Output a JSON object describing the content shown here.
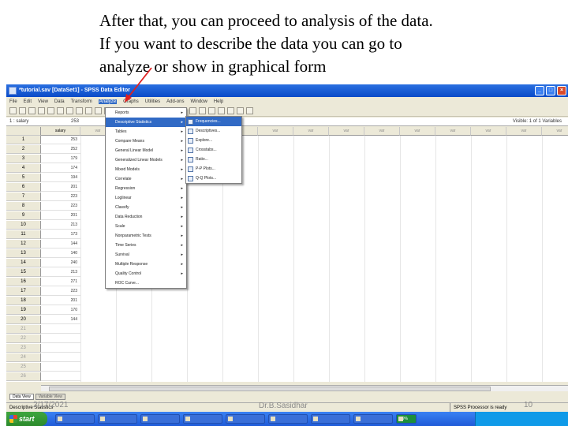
{
  "caption": {
    "line1": "After that, you can proceed to analysis of the data.",
    "line2": "If you want to describe the data you can go to",
    "line3": "analyze  or show in graphical form"
  },
  "window": {
    "title": "*tutorial.sav [DataSet1] - SPSS Data Editor"
  },
  "menubar": [
    "File",
    "Edit",
    "View",
    "Data",
    "Transform",
    "Analyze",
    "Graphs",
    "Utilities",
    "Add-ons",
    "Window",
    "Help"
  ],
  "cellbar": {
    "ref": "1 : salary",
    "value": "253",
    "visible": "Visible: 1 of 1 Variables"
  },
  "grid": {
    "first_column_header": "salary",
    "empty_header": "var",
    "rows": [
      {
        "n": "1",
        "v": "253"
      },
      {
        "n": "2",
        "v": "252"
      },
      {
        "n": "3",
        "v": "179"
      },
      {
        "n": "4",
        "v": "174"
      },
      {
        "n": "5",
        "v": "194"
      },
      {
        "n": "6",
        "v": "201"
      },
      {
        "n": "7",
        "v": "223"
      },
      {
        "n": "8",
        "v": "223"
      },
      {
        "n": "9",
        "v": "201"
      },
      {
        "n": "10",
        "v": "213"
      },
      {
        "n": "11",
        "v": "173"
      },
      {
        "n": "12",
        "v": "144"
      },
      {
        "n": "13",
        "v": "140"
      },
      {
        "n": "14",
        "v": "240"
      },
      {
        "n": "15",
        "v": "213"
      },
      {
        "n": "16",
        "v": "271"
      },
      {
        "n": "17",
        "v": "223"
      },
      {
        "n": "18",
        "v": "201"
      },
      {
        "n": "19",
        "v": "170"
      },
      {
        "n": "20",
        "v": "144"
      },
      {
        "n": "21",
        "v": ""
      },
      {
        "n": "22",
        "v": ""
      },
      {
        "n": "23",
        "v": ""
      },
      {
        "n": "24",
        "v": ""
      },
      {
        "n": "25",
        "v": ""
      },
      {
        "n": "26",
        "v": ""
      }
    ]
  },
  "analyze_menu": [
    {
      "label": "Reports",
      "sub": true
    },
    {
      "label": "Descriptive Statistics",
      "sub": true,
      "highlight": true
    },
    {
      "label": "Tables",
      "sub": true
    },
    {
      "label": "Compare Means",
      "sub": true
    },
    {
      "label": "General Linear Model",
      "sub": true
    },
    {
      "label": "Generalized Linear Models",
      "sub": true
    },
    {
      "label": "Mixed Models",
      "sub": true
    },
    {
      "label": "Correlate",
      "sub": true
    },
    {
      "label": "Regression",
      "sub": true
    },
    {
      "label": "Loglinear",
      "sub": true
    },
    {
      "label": "Classify",
      "sub": true
    },
    {
      "label": "Data Reduction",
      "sub": true
    },
    {
      "label": "Scale",
      "sub": true
    },
    {
      "label": "Nonparametric Tests",
      "sub": true
    },
    {
      "label": "Time Series",
      "sub": true
    },
    {
      "label": "Survival",
      "sub": true
    },
    {
      "label": "Multiple Response",
      "sub": true
    },
    {
      "label": "Quality Control",
      "sub": true
    },
    {
      "label": "ROC Curve...",
      "sub": false
    }
  ],
  "descriptive_submenu": [
    "Frequencies...",
    "Descriptives...",
    "Explore...",
    "Crosstabs...",
    "Ratio...",
    "P-P Plots...",
    "Q-Q Plots..."
  ],
  "tabs": {
    "data_view": "Data View",
    "variable_view": "Variable View"
  },
  "statusbar": {
    "left": "Descriptive Statistics",
    "processor": "SPSS  Processor is ready"
  },
  "taskbar": {
    "start": "start",
    "zoom": "99%"
  },
  "footer": {
    "date": "2/17/2021",
    "author": "Dr.B.Sasidhar",
    "page": "10"
  }
}
